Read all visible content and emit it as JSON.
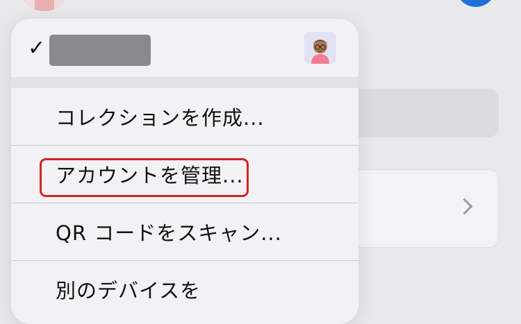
{
  "menu": {
    "header": {
      "checkmark": "✓",
      "account_name": "",
      "avatar_icon": "memoji-avatar-icon"
    },
    "items": [
      {
        "label": "コレクションを作成..."
      },
      {
        "label": "アカウントを管理...",
        "highlighted": true
      },
      {
        "label": "QR コードをスキャン..."
      },
      {
        "label": "別のデバイスを"
      }
    ]
  },
  "colors": {
    "highlight": "#d9201f",
    "accent": "#1f6fd8"
  }
}
